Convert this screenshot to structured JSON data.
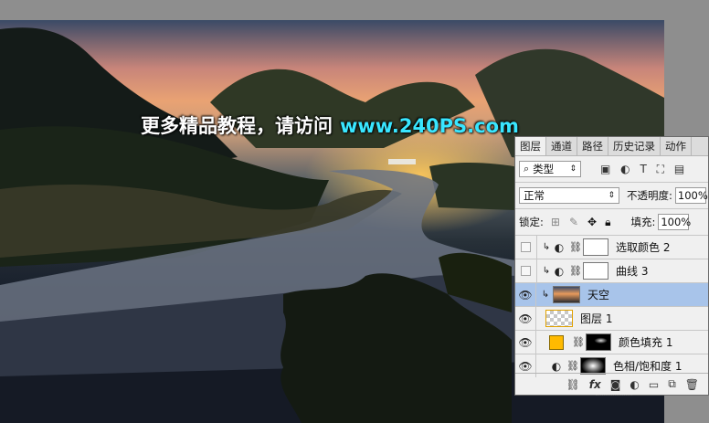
{
  "watermark": {
    "text": "更多精品教程，请访问",
    "url": "www.240PS.com"
  },
  "panel": {
    "tabs": [
      "图层",
      "通道",
      "路径",
      "历史记录",
      "动作"
    ],
    "filter": {
      "icon": "search-icon",
      "label": "类型"
    },
    "blend_mode": "正常",
    "opacity_label": "不透明度:",
    "opacity_value": "100%",
    "lock_label": "锁定:",
    "fill_label": "填充:",
    "fill_value": "100%",
    "layers": [
      {
        "name": "选取颜色 2",
        "visible": false,
        "type": "adjustment",
        "clipped": true
      },
      {
        "name": "曲线 3",
        "visible": false,
        "type": "adjustment",
        "clipped": true
      },
      {
        "name": "天空",
        "visible": true,
        "type": "smart-object",
        "clipped": true,
        "selected": true
      },
      {
        "name": "图层 1",
        "visible": true,
        "type": "pixel"
      },
      {
        "name": "颜色填充 1",
        "visible": true,
        "type": "fill",
        "color": "#ffba00"
      },
      {
        "name": "色相/饱和度 1",
        "visible": true,
        "type": "adjustment"
      }
    ]
  },
  "colors": {
    "watermark_url": "#39e6ff",
    "selected_layer": "#a8c4ea",
    "fill_swatch": "#ffba00"
  }
}
